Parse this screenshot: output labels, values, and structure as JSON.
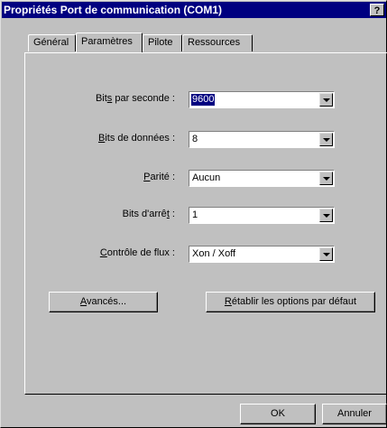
{
  "window": {
    "title": "Propriétés Port de communication (COM1)",
    "help_label": "?"
  },
  "tabs": [
    {
      "label": "Général",
      "active": false
    },
    {
      "label": "Paramètres",
      "active": true
    },
    {
      "label": "Pilote",
      "active": false
    },
    {
      "label": "Ressources",
      "active": false
    }
  ],
  "fields": {
    "bits_per_second": {
      "label_pre": "Bit",
      "label_key": "s",
      "label_post": " par seconde :",
      "value": "9600"
    },
    "data_bits": {
      "label_pre": "",
      "label_key": "B",
      "label_post": "its de données :",
      "value": "8"
    },
    "parity": {
      "label_pre": "",
      "label_key": "P",
      "label_post": "arité :",
      "value": "Aucun"
    },
    "stop_bits": {
      "label_pre": "Bits d'arrê",
      "label_key": "t",
      "label_post": " :",
      "value": "1"
    },
    "flow_control": {
      "label_pre": "",
      "label_key": "C",
      "label_post": "ontrôle de flux :",
      "value": "Xon / Xoff"
    }
  },
  "buttons": {
    "advanced": {
      "key": "A",
      "rest": "vancés..."
    },
    "restore": {
      "key": "R",
      "rest": "établir les options par défaut"
    },
    "ok": "OK",
    "cancel": "Annuler"
  }
}
